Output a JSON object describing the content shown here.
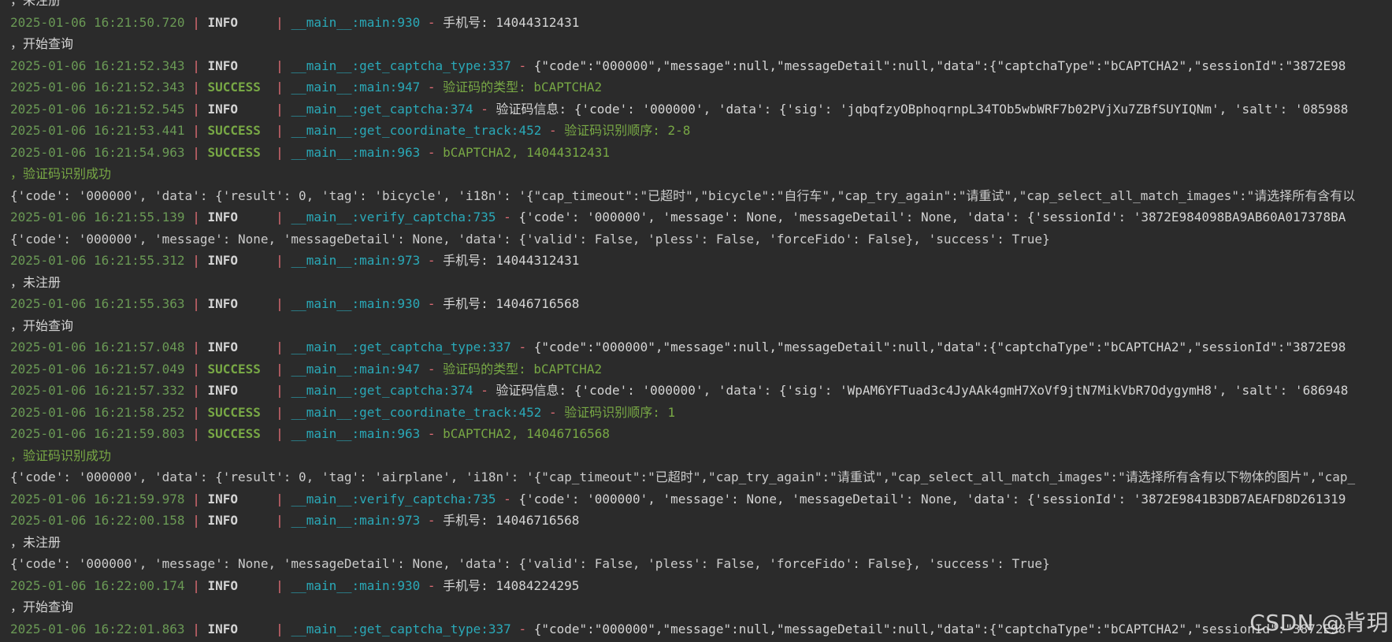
{
  "colors": {
    "background": "#2b2b2b",
    "timestamp": "#6a9955",
    "separator": "#e06c75",
    "level_info": "#d4d4d4",
    "level_success": "#78a845",
    "location": "#2aa9b8"
  },
  "watermark": "CSDN @背玥",
  "lines": [
    {
      "kind": "cont",
      "level": "INFO",
      "text": "，未注册"
    },
    {
      "kind": "log",
      "ts": "2025-01-06 16:21:50.720",
      "level": "INFO",
      "levelpad": "INFO    ",
      "func": "__main__:main",
      "line": "930",
      "msg": "手机号: 14044312431"
    },
    {
      "kind": "cont",
      "level": "INFO",
      "text": "，开始查询"
    },
    {
      "kind": "log",
      "ts": "2025-01-06 16:21:52.343",
      "level": "INFO",
      "levelpad": "INFO    ",
      "func": "__main__:get_captcha_type",
      "line": "337",
      "msg": "{\"code\":\"000000\",\"message\":null,\"messageDetail\":null,\"data\":{\"captchaType\":\"bCAPTCHA2\",\"sessionId\":\"3872E98"
    },
    {
      "kind": "log",
      "ts": "2025-01-06 16:21:52.343",
      "level": "SUCCESS",
      "levelpad": "SUCCESS ",
      "func": "__main__:main",
      "line": "947",
      "msg": "验证码的类型: bCAPTCHA2"
    },
    {
      "kind": "log",
      "ts": "2025-01-06 16:21:52.545",
      "level": "INFO",
      "levelpad": "INFO    ",
      "func": "__main__:get_captcha",
      "line": "374",
      "msg": "验证码信息: {'code': '000000', 'data': {'sig': 'jqbqfzyOBphoqrnpL34TOb5wbWRF7b02PVjXu7ZBfSUYIQNm', 'salt': '085988"
    },
    {
      "kind": "log",
      "ts": "2025-01-06 16:21:53.441",
      "level": "SUCCESS",
      "levelpad": "SUCCESS ",
      "func": "__main__:get_coordinate_track",
      "line": "452",
      "msg": "验证码识别顺序: 2-8"
    },
    {
      "kind": "log",
      "ts": "2025-01-06 16:21:54.963",
      "level": "SUCCESS",
      "levelpad": "SUCCESS ",
      "func": "__main__:main",
      "line": "963",
      "msg": "bCAPTCHA2, 14044312431"
    },
    {
      "kind": "cont",
      "level": "SUCCESS",
      "text": "，验证码识别成功"
    },
    {
      "kind": "plain",
      "text": "{'code': '000000', 'data': {'result': 0, 'tag': 'bicycle', 'i18n': '{\"cap_timeout\":\"已超时\",\"bicycle\":\"自行车\",\"cap_try_again\":\"请重试\",\"cap_select_all_match_images\":\"请选择所有含有以"
    },
    {
      "kind": "log",
      "ts": "2025-01-06 16:21:55.139",
      "level": "INFO",
      "levelpad": "INFO    ",
      "func": "__main__:verify_captcha",
      "line": "735",
      "msg": "{'code': '000000', 'message': None, 'messageDetail': None, 'data': {'sessionId': '3872E984098BA9AB60A017378BA"
    },
    {
      "kind": "plain",
      "text": "{'code': '000000', 'message': None, 'messageDetail': None, 'data': {'valid': False, 'pless': False, 'forceFido': False}, 'success': True}"
    },
    {
      "kind": "log",
      "ts": "2025-01-06 16:21:55.312",
      "level": "INFO",
      "levelpad": "INFO    ",
      "func": "__main__:main",
      "line": "973",
      "msg": "手机号: 14044312431"
    },
    {
      "kind": "cont",
      "level": "INFO",
      "text": "，未注册"
    },
    {
      "kind": "log",
      "ts": "2025-01-06 16:21:55.363",
      "level": "INFO",
      "levelpad": "INFO    ",
      "func": "__main__:main",
      "line": "930",
      "msg": "手机号: 14046716568"
    },
    {
      "kind": "cont",
      "level": "INFO",
      "text": "，开始查询"
    },
    {
      "kind": "log",
      "ts": "2025-01-06 16:21:57.048",
      "level": "INFO",
      "levelpad": "INFO    ",
      "func": "__main__:get_captcha_type",
      "line": "337",
      "msg": "{\"code\":\"000000\",\"message\":null,\"messageDetail\":null,\"data\":{\"captchaType\":\"bCAPTCHA2\",\"sessionId\":\"3872E98"
    },
    {
      "kind": "log",
      "ts": "2025-01-06 16:21:57.049",
      "level": "SUCCESS",
      "levelpad": "SUCCESS ",
      "func": "__main__:main",
      "line": "947",
      "msg": "验证码的类型: bCAPTCHA2"
    },
    {
      "kind": "log",
      "ts": "2025-01-06 16:21:57.332",
      "level": "INFO",
      "levelpad": "INFO    ",
      "func": "__main__:get_captcha",
      "line": "374",
      "msg": "验证码信息: {'code': '000000', 'data': {'sig': 'WpAM6YFTuad3c4JyAAk4gmH7XoVf9jtN7MikVbR7OdygymH8', 'salt': '686948"
    },
    {
      "kind": "log",
      "ts": "2025-01-06 16:21:58.252",
      "level": "SUCCESS",
      "levelpad": "SUCCESS ",
      "func": "__main__:get_coordinate_track",
      "line": "452",
      "msg": "验证码识别顺序: 1"
    },
    {
      "kind": "log",
      "ts": "2025-01-06 16:21:59.803",
      "level": "SUCCESS",
      "levelpad": "SUCCESS ",
      "func": "__main__:main",
      "line": "963",
      "msg": "bCAPTCHA2, 14046716568"
    },
    {
      "kind": "cont",
      "level": "SUCCESS",
      "text": "，验证码识别成功"
    },
    {
      "kind": "plain",
      "text": "{'code': '000000', 'data': {'result': 0, 'tag': 'airplane', 'i18n': '{\"cap_timeout\":\"已超时\",\"cap_try_again\":\"请重试\",\"cap_select_all_match_images\":\"请选择所有含有以下物体的图片\",\"cap_"
    },
    {
      "kind": "log",
      "ts": "2025-01-06 16:21:59.978",
      "level": "INFO",
      "levelpad": "INFO    ",
      "func": "__main__:verify_captcha",
      "line": "735",
      "msg": "{'code': '000000', 'message': None, 'messageDetail': None, 'data': {'sessionId': '3872E9841B3DB7AEAFD8D261319"
    },
    {
      "kind": "log",
      "ts": "2025-01-06 16:22:00.158",
      "level": "INFO",
      "levelpad": "INFO    ",
      "func": "__main__:main",
      "line": "973",
      "msg": "手机号: 14046716568"
    },
    {
      "kind": "cont",
      "level": "INFO",
      "text": "，未注册"
    },
    {
      "kind": "plain",
      "text": "{'code': '000000', 'message': None, 'messageDetail': None, 'data': {'valid': False, 'pless': False, 'forceFido': False}, 'success': True}"
    },
    {
      "kind": "log",
      "ts": "2025-01-06 16:22:00.174",
      "level": "INFO",
      "levelpad": "INFO    ",
      "func": "__main__:main",
      "line": "930",
      "msg": "手机号: 14084224295"
    },
    {
      "kind": "cont",
      "level": "INFO",
      "text": "，开始查询"
    },
    {
      "kind": "log",
      "ts": "2025-01-06 16:22:01.863",
      "level": "INFO",
      "levelpad": "INFO    ",
      "func": "__main__:get_captcha_type",
      "line": "337",
      "msg": "{\"code\":\"000000\",\"message\":null,\"messageDetail\":null,\"data\":{\"captchaType\":\"bCAPTCHA2\",\"sessionId\":\"3872E98"
    }
  ]
}
